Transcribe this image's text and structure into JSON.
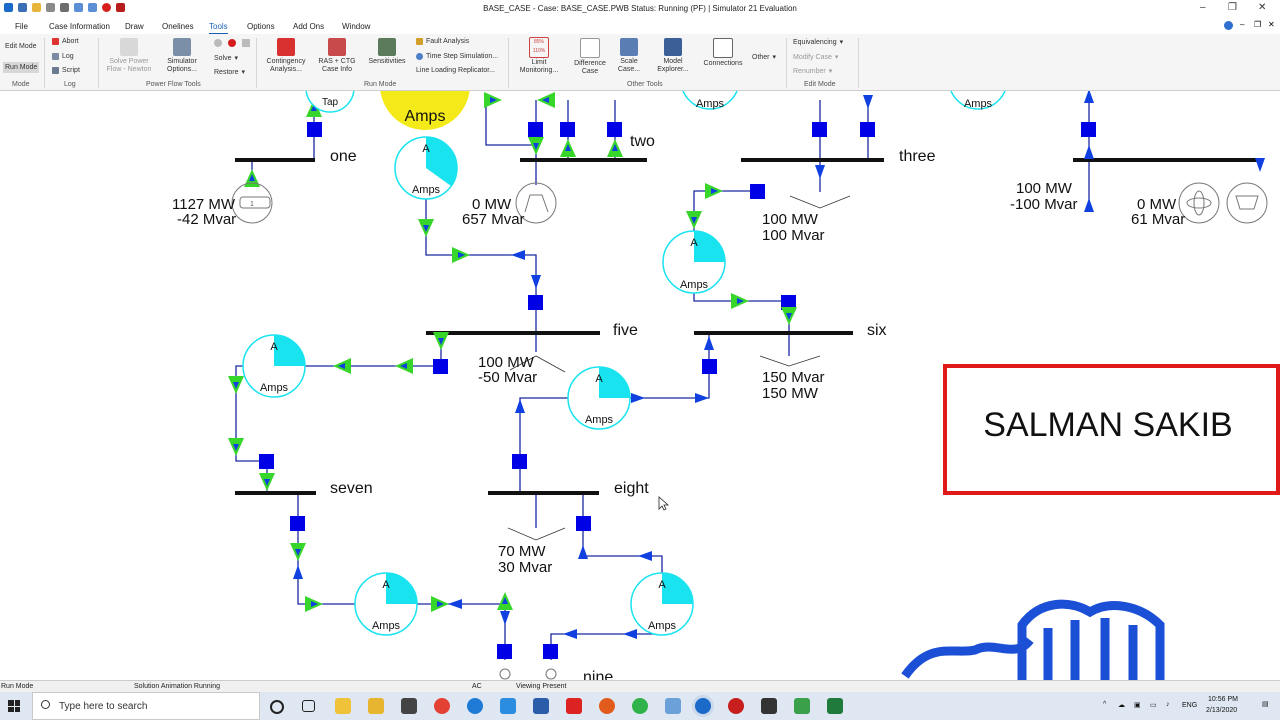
{
  "window": {
    "title": "BASE_CASE - Case: BASE_CASE.PWB  Status: Running (PF) | Simulator 21 Evaluation"
  },
  "menu": {
    "tabs": [
      "File",
      "Case Information",
      "Draw",
      "Onelines",
      "Tools",
      "Options",
      "Add Ons",
      "Window"
    ],
    "active": "Tools"
  },
  "ribbon": {
    "mode": {
      "edit": "Edit Mode",
      "run": "Run Mode",
      "group": "Mode"
    },
    "log": {
      "abort": "Abort",
      "log": "Log",
      "script": "Script",
      "group": "Log"
    },
    "power_flow": {
      "solve_pf_1": "Solve Power",
      "solve_pf_2": "Flow - Newton",
      "sim_options_1": "Simulator",
      "sim_options_2": "Options...",
      "solve": "Solve",
      "restore": "Restore",
      "group": "Power Flow Tools"
    },
    "run_mode": {
      "contingency_1": "Contingency",
      "contingency_2": "Analysis...",
      "ras_1": "RAS + CTG",
      "ras_2": "Case Info",
      "sens": "Sensitivities",
      "fault": "Fault Analysis",
      "timestep": "Time Step Simulation...",
      "line_loading": "Line Loading Replicator...",
      "group": "Run Mode"
    },
    "other_tools": {
      "limit_1": "Limit",
      "limit_2": "Monitoring...",
      "diff_1": "Difference",
      "diff_2": "Case",
      "scale_1": "Scale",
      "scale_2": "Case...",
      "model_1": "Model",
      "model_2": "Explorer...",
      "connections": "Connections",
      "other": "Other",
      "group": "Other Tools"
    },
    "edit_mode": {
      "equivalencing": "Equivalencing",
      "modify": "Modify Case",
      "renumber": "Renumber",
      "group": "Edit Mode"
    },
    "limit_pct_1": "85%",
    "limit_pct_2": "110%"
  },
  "oneline": {
    "buses": {
      "one": "one",
      "two": "two",
      "three": "three",
      "five": "five",
      "six": "six",
      "seven": "seven",
      "eight": "eight",
      "nine": "nine"
    },
    "gen_one": {
      "mw": "1127 MW",
      "mvar": "-42 Mvar"
    },
    "gen_two": {
      "mw": "0 MW",
      "mvar": "657 Mvar"
    },
    "load_three": {
      "mw": "100 MW",
      "mvar": "100 Mvar"
    },
    "gen_four": {
      "mw": "100 MW",
      "mvar": "-100 Mvar"
    },
    "gen_four_b": {
      "mw": "0 MW",
      "mvar": "61 Mvar"
    },
    "load_five": {
      "mw": "100 MW",
      "mvar": "-50 Mvar"
    },
    "load_six": {
      "line1": "150 Mvar",
      "line2": "150 MW"
    },
    "load_eight": {
      "mw": "70 MW",
      "mvar": "30 Mvar"
    },
    "amps": "Amps",
    "a": "A",
    "tap": "Tap",
    "big_amps": "Amps",
    "owner_label": "SALMAN SAKIB",
    "gen_symbol": "1"
  },
  "status": {
    "mode": "Run Mode",
    "animation": "Solution Animation Running",
    "ac": "AC",
    "viewing": "Viewing Present"
  },
  "taskbar": {
    "search": "Type here to search",
    "lang": "ENG",
    "time": "10:56 PM",
    "date": "2/13/2020"
  },
  "colors": {
    "flow_arrow": "#37d62a",
    "breaker": "#0000e6",
    "gauge": "#19e3ef",
    "bus": "#111111",
    "label_box": "#e01919"
  }
}
